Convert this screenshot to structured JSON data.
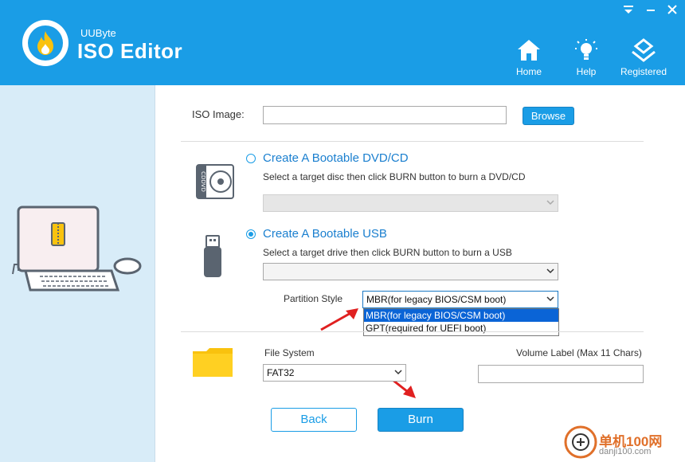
{
  "app": {
    "brand_small": "UUByte",
    "brand_big": "ISO Editor"
  },
  "nav": {
    "home": "Home",
    "help": "Help",
    "registered": "Registered"
  },
  "iso": {
    "label": "ISO Image:",
    "value": "",
    "browse": "Browse"
  },
  "dvd": {
    "title": "Create A Bootable DVD/CD",
    "desc": "Select a target disc then click BURN button to burn a DVD/CD",
    "selected": false,
    "drive_value": ""
  },
  "usb": {
    "title": "Create A Bootable USB",
    "desc": "Select a target drive then click BURN button to burn a USB",
    "selected": true,
    "drive_value": ""
  },
  "partition": {
    "label": "Partition Style",
    "value": "MBR(for legacy BIOS/CSM boot)",
    "options": [
      "MBR(for legacy BIOS/CSM boot)",
      "GPT(required for UEFI boot)"
    ]
  },
  "filesystem": {
    "label": "File System",
    "value": "FAT32"
  },
  "volume": {
    "label": "Volume Label (Max 11 Chars)",
    "value": ""
  },
  "buttons": {
    "back": "Back",
    "burn": "Burn"
  },
  "watermark": {
    "text": "单机100网",
    "sub": "danji100.com"
  },
  "colors": {
    "accent": "#1a9de6",
    "sidebar": "#d8ecf8",
    "arrow": "#e02020",
    "folder": "#f9c20e"
  }
}
